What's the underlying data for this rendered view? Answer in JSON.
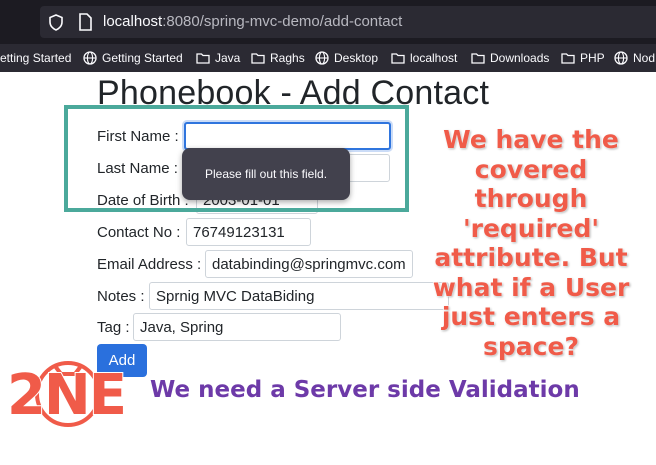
{
  "browser": {
    "url_host": "localhost",
    "url_path": ":8080/spring-mvc-demo/add-contact",
    "bookmarks": [
      "etting Started",
      "Getting Started",
      "Java",
      "Raghs",
      "Desktop",
      "localhost",
      "Downloads",
      "PHP",
      "Nod"
    ]
  },
  "page": {
    "title": "Phonebook - Add Contact",
    "form": {
      "first_name_label": "First Name :",
      "first_name_value": "",
      "last_name_label": "Last Name :",
      "last_name_value": "",
      "dob_label": "Date of Birth :",
      "dob_value": "2003-01-01",
      "contact_label": "Contact No :",
      "contact_value": "76749123131",
      "email_label": "Email Address :",
      "email_value": "databinding@springmvc.com",
      "notes_label": "Notes :",
      "notes_value": "Sprnig MVC DataBiding",
      "tag_label": "Tag :",
      "tag_value": "Java, Spring",
      "add_button": "Add"
    },
    "validation_tooltip": "Please fill out this field."
  },
  "annotations": {
    "red_note_lines": [
      "We have the",
      "covered through",
      "'required'",
      "attribute. But",
      "what if a User",
      "just enters a",
      "space?"
    ],
    "purple_note": "We need a Server side Validation",
    "logo_text": "2NE"
  },
  "colors": {
    "red_note": "#f05b49",
    "purple_note": "#6d3aa8",
    "highlight_border": "#4ba99b",
    "button": "#2a70dd"
  }
}
